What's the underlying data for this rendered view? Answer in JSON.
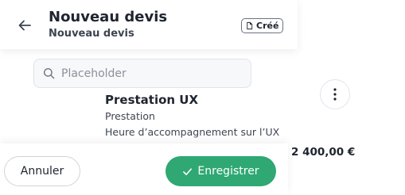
{
  "header": {
    "title": "Nouveau devis",
    "subtitle": "Nouveau devis",
    "back_icon": "arrow-left-icon",
    "status_badge": {
      "label": "Créé",
      "icon": "document-icon"
    }
  },
  "search": {
    "placeholder": "Placeholder",
    "value": "",
    "icon": "search-icon"
  },
  "item": {
    "title": "Prestation UX",
    "type": "Prestation",
    "description": "Heure d’accompagnement sur l’UX",
    "price": "2 400,00 €",
    "menu_icon": "more-vertical-icon"
  },
  "footer": {
    "cancel_label": "Annuler",
    "save_label": "Enregistrer",
    "save_icon": "check-icon"
  },
  "colors": {
    "primary": "#2fa873",
    "text": "#1f2430",
    "muted": "#8a919b"
  }
}
